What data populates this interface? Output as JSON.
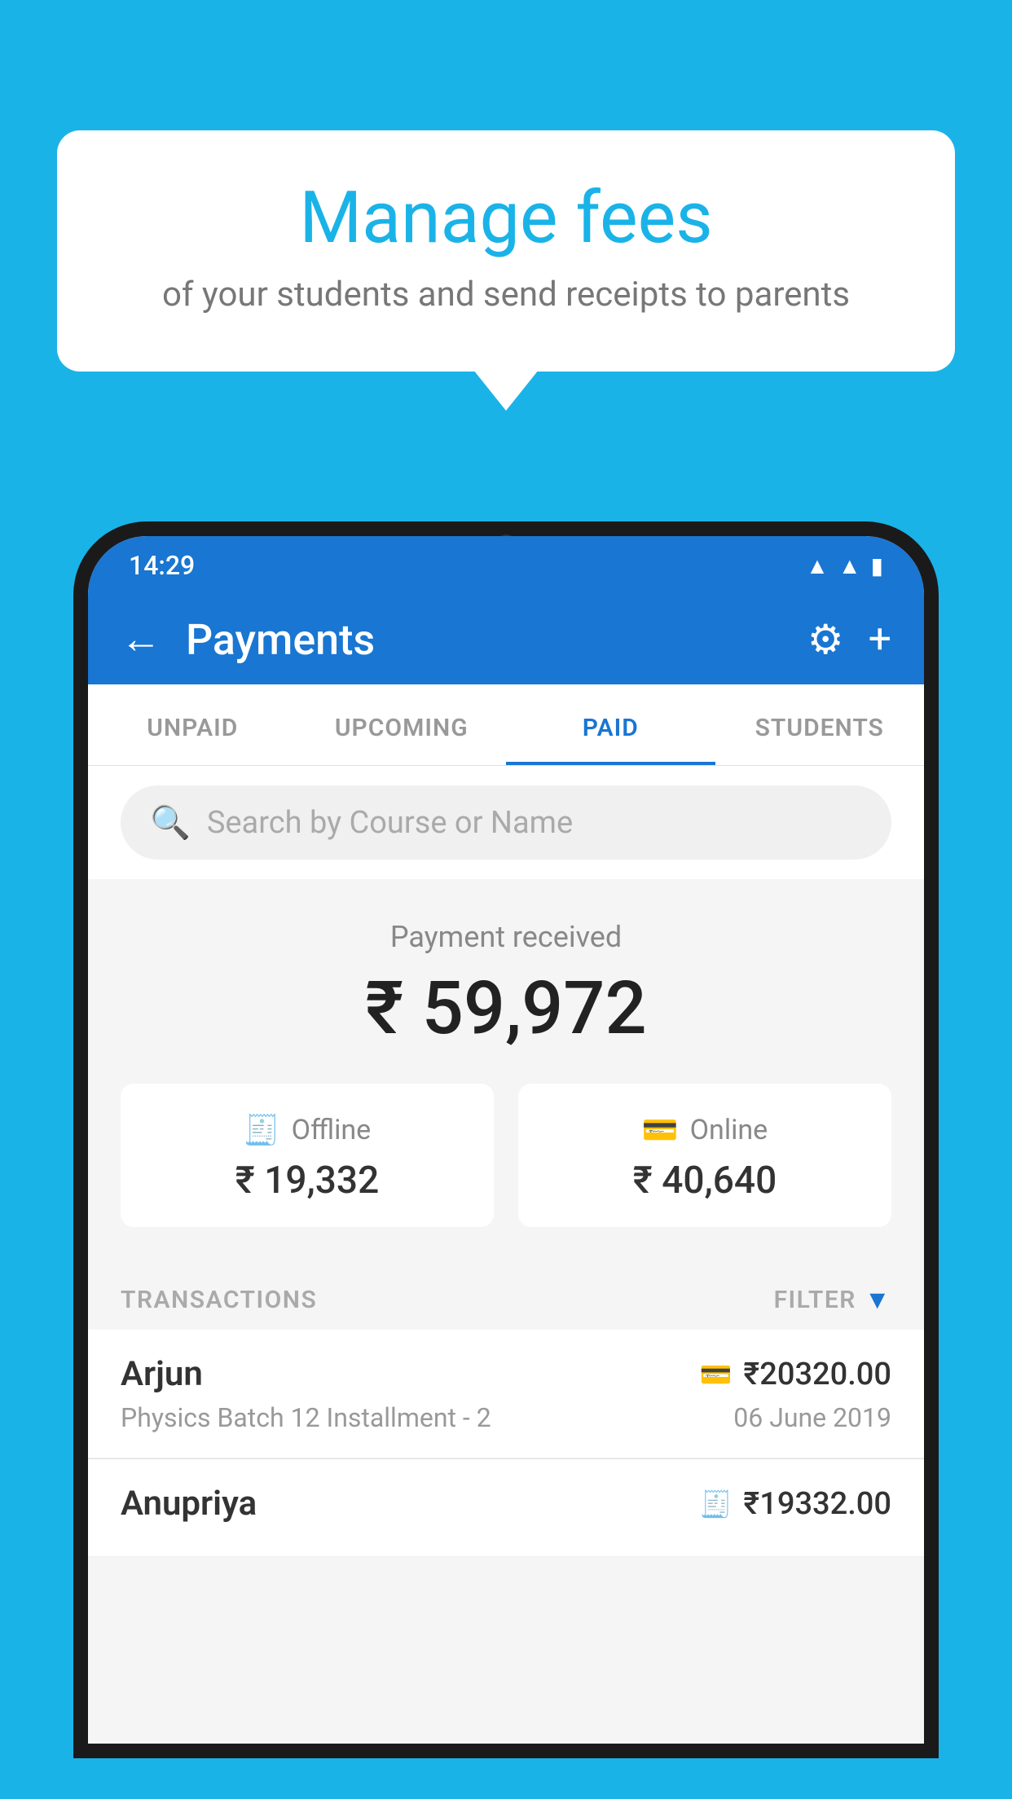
{
  "background": {
    "color": "#1ab3e8"
  },
  "bubble": {
    "title": "Manage fees",
    "subtitle": "of your students and send receipts to parents"
  },
  "phone": {
    "status_bar": {
      "time": "14:29",
      "icons": [
        "wifi",
        "signal",
        "battery"
      ]
    },
    "app_bar": {
      "title": "Payments",
      "back_label": "←",
      "gear_label": "⚙",
      "plus_label": "+"
    },
    "tabs": [
      {
        "label": "UNPAID",
        "active": false
      },
      {
        "label": "UPCOMING",
        "active": false
      },
      {
        "label": "PAID",
        "active": true
      },
      {
        "label": "STUDENTS",
        "active": false
      }
    ],
    "search": {
      "placeholder": "Search by Course or Name"
    },
    "payment_summary": {
      "label": "Payment received",
      "amount": "₹ 59,972",
      "offline": {
        "label": "Offline",
        "amount": "₹ 19,332",
        "icon": "💳"
      },
      "online": {
        "label": "Online",
        "amount": "₹ 40,640",
        "icon": "💳"
      }
    },
    "transactions": {
      "header_label": "TRANSACTIONS",
      "filter_label": "FILTER",
      "items": [
        {
          "name": "Arjun",
          "amount": "₹20320.00",
          "course": "Physics Batch 12 Installment - 2",
          "date": "06 June 2019",
          "payment_type": "online"
        },
        {
          "name": "Anupriya",
          "amount": "₹19332.00",
          "course": "",
          "date": "",
          "payment_type": "offline"
        }
      ]
    }
  }
}
